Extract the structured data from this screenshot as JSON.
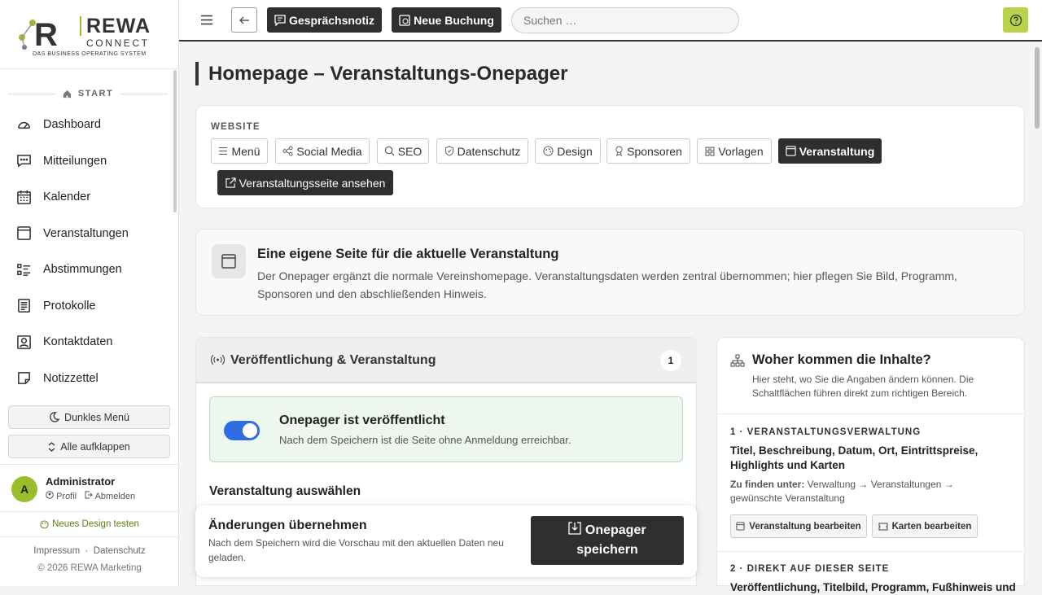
{
  "brand": {
    "name": "REWA",
    "connect": "CONNECT",
    "tagline": "Das Business Operating System"
  },
  "sidebar": {
    "section": "START",
    "items": [
      {
        "label": "Dashboard",
        "icon": "gauge-icon"
      },
      {
        "label": "Mitteilungen",
        "icon": "chat-icon"
      },
      {
        "label": "Kalender",
        "icon": "calendar-icon"
      },
      {
        "label": "Veranstaltungen",
        "icon": "event-icon"
      },
      {
        "label": "Abstimmungen",
        "icon": "checklist-icon"
      },
      {
        "label": "Protokolle",
        "icon": "document-icon"
      },
      {
        "label": "Kontaktdaten",
        "icon": "contact-card-icon"
      },
      {
        "label": "Notizzettel",
        "icon": "sticky-note-icon"
      }
    ],
    "dark_menu": "Dunkles Menü",
    "expand_all": "Alle aufklappen",
    "user": {
      "initial": "A",
      "name": "Administrator",
      "profile": "Profil",
      "logout": "Abmelden"
    },
    "new_design": "Neues Design testen",
    "impressum": "Impressum",
    "datenschutz": "Datenschutz",
    "separator": "·",
    "copyright": "© 2026 REWA Marketing"
  },
  "topbar": {
    "note_btn": "Gesprächsnotiz",
    "booking_btn": "Neue Buchung",
    "search_placeholder": "Suchen …"
  },
  "page": {
    "title": "Homepage – Veranstaltungs-Onepager"
  },
  "website": {
    "label": "WEBSITE",
    "chips": [
      "Menü",
      "Social Media",
      "SEO",
      "Datenschutz",
      "Design",
      "Sponsoren",
      "Vorlagen",
      "Veranstaltung"
    ],
    "view_btn": "Veranstaltungsseite ansehen"
  },
  "info": {
    "title": "Eine eigene Seite für die aktuelle Veranstaltung",
    "text": "Der Onepager ergänzt die normale Vereinshomepage. Veranstaltungsdaten werden zentral übernommen; hier pflegen Sie Bild, Programm, Sponsoren und den abschließenden Hinweis."
  },
  "publish": {
    "title": "Veröffentlichung & Veranstaltung",
    "count": "1",
    "toggle_title": "Onepager ist veröffentlicht",
    "toggle_text": "Nach dem Speichern ist die Seite ohne Anmeldung erreichbar.",
    "select_label": "Veranstaltung auswählen"
  },
  "save": {
    "title": "Änderungen übernehmen",
    "text": "Nach dem Speichern wird die Vorschau mit den aktuellen Daten neu geladen.",
    "btn_line1": "Onepager",
    "btn_line2": "speichern"
  },
  "sources": {
    "title": "Woher kommen die Inhalte?",
    "subtitle": "Hier steht, wo Sie die Angaben ändern können. Die Schaltflächen führen direkt zum richtigen Bereich.",
    "step1_label": "1 · VERANSTALTUNGSVERWALTUNG",
    "step1_title": "Titel, Beschreibung, Datum, Ort, Eintrittspreise, Highlights und Karten",
    "step1_find_label": "Zu finden unter:",
    "step1_find_text": "Verwaltung → Veranstaltungen → gewünschte Veranstaltung",
    "btn_event": "Veranstaltung bearbeiten",
    "btn_cards": "Karten bearbeiten",
    "step2_label": "2 · DIREKT AUF DIESER SEITE",
    "step2_title": "Veröffentlichung, Titelbild, Programm, Fußhinweis und"
  }
}
